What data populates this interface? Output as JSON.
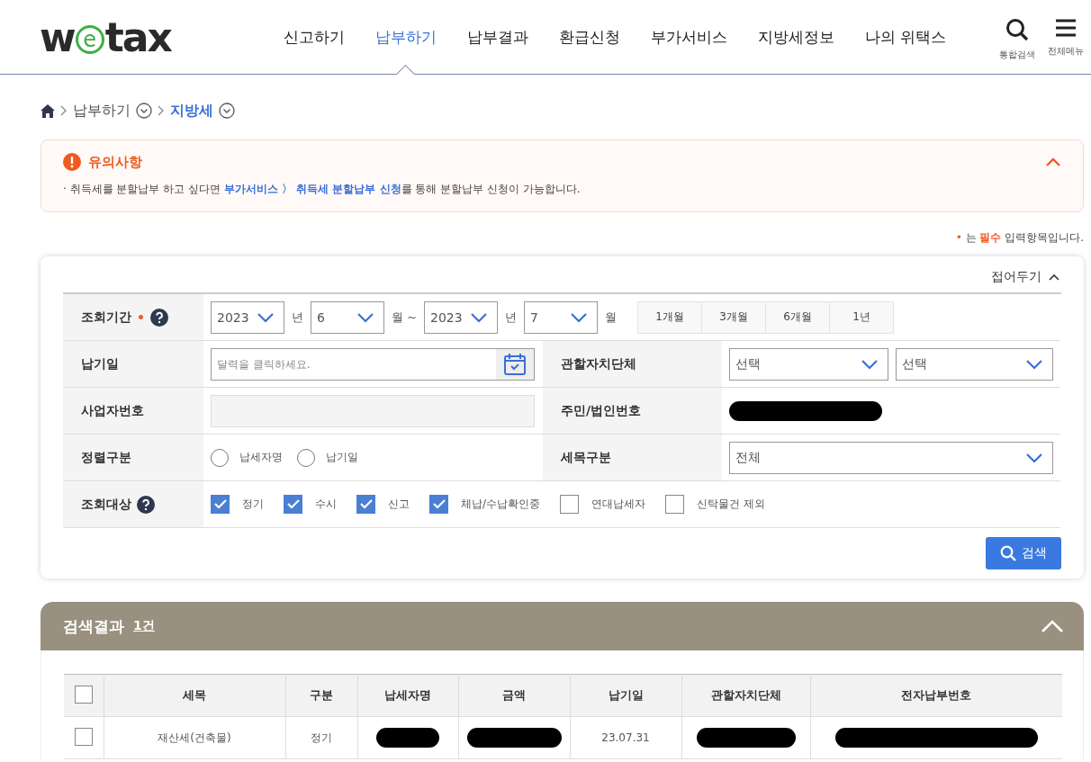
{
  "header": {
    "logo": {
      "before": "w",
      "circle": "e",
      "after": "tax"
    },
    "nav": [
      {
        "label": "신고하기",
        "selected": false
      },
      {
        "label": "납부하기",
        "selected": true
      },
      {
        "label": "납부결과",
        "selected": false
      },
      {
        "label": "환급신청",
        "selected": false
      },
      {
        "label": "부가서비스",
        "selected": false
      },
      {
        "label": "지방세정보",
        "selected": false
      },
      {
        "label": "나의 위택스",
        "selected": false
      }
    ],
    "tools": [
      {
        "kind": "search",
        "label": "통합검색"
      },
      {
        "kind": "menu",
        "label": "전체메뉴"
      }
    ]
  },
  "breadcrumb": [
    {
      "label": "납부하기",
      "current": false
    },
    {
      "label": "지방세",
      "current": true
    }
  ],
  "notice": {
    "title": "유의사항",
    "expanded": true,
    "text": "· 취득세를 분할납부 하고 싶다면 **부가서비스 〉 취득세 분할납부 신청**를 통해 분할납부 신청이 가능합니다."
  },
  "required_note": {
    "mark": "•",
    "before": "는",
    "strong": "필수",
    "after": "입력항목입니다."
  },
  "form": {
    "collapse": "접어두기",
    "period": {
      "label": "조회기간",
      "required_mark": "•",
      "from_year": "2023",
      "year_unit_1": "년",
      "from_month": "6",
      "month_unit_1": "월 ~",
      "to_year": "2023",
      "year_unit_2": "년",
      "to_month": "7",
      "month_unit_2": "월",
      "ranges": [
        "1개월",
        "3개월",
        "6개월",
        "1년"
      ]
    },
    "due_date": {
      "label": "납기일",
      "placeholder": "달력을 클릭하세요."
    },
    "district": {
      "label": "관할자치단체",
      "select_1": "선택",
      "select_2": "선택"
    },
    "business_no": {
      "label": "사업자번호"
    },
    "resident_no": {
      "label": "주민/법인번호",
      "redacted": true
    },
    "sort": {
      "label": "정렬구분",
      "options": [
        {
          "label": "납세자명",
          "selected": false
        },
        {
          "label": "납기일",
          "selected": false
        }
      ]
    },
    "tax_type": {
      "label": "세목구분",
      "value": "전체"
    },
    "targets": {
      "label": "조회대상",
      "options": [
        {
          "label": "정기",
          "checked": true
        },
        {
          "label": "수시",
          "checked": true
        },
        {
          "label": "신고",
          "checked": true
        },
        {
          "label": "체납/수납확인중",
          "checked": true
        },
        {
          "label": "연대납세자",
          "checked": false
        },
        {
          "label": "신탁물건 제외",
          "checked": false
        }
      ]
    },
    "search_button": "검색"
  },
  "results": {
    "title": "검색결과",
    "count": "1건",
    "expanded": true,
    "columns": [
      "세목",
      "구분",
      "납세자명",
      "금액",
      "납기일",
      "관할자치단체",
      "전자납부번호"
    ],
    "all_checked": false,
    "rows": [
      {
        "checked": false,
        "cells": [
          {
            "text": "재산세(건축물)"
          },
          {
            "text": "정기"
          },
          {
            "redacted": true
          },
          {
            "redacted": true
          },
          {
            "text": "23.07.31"
          },
          {
            "redacted": true
          },
          {
            "redacted": true
          }
        ]
      }
    ]
  }
}
